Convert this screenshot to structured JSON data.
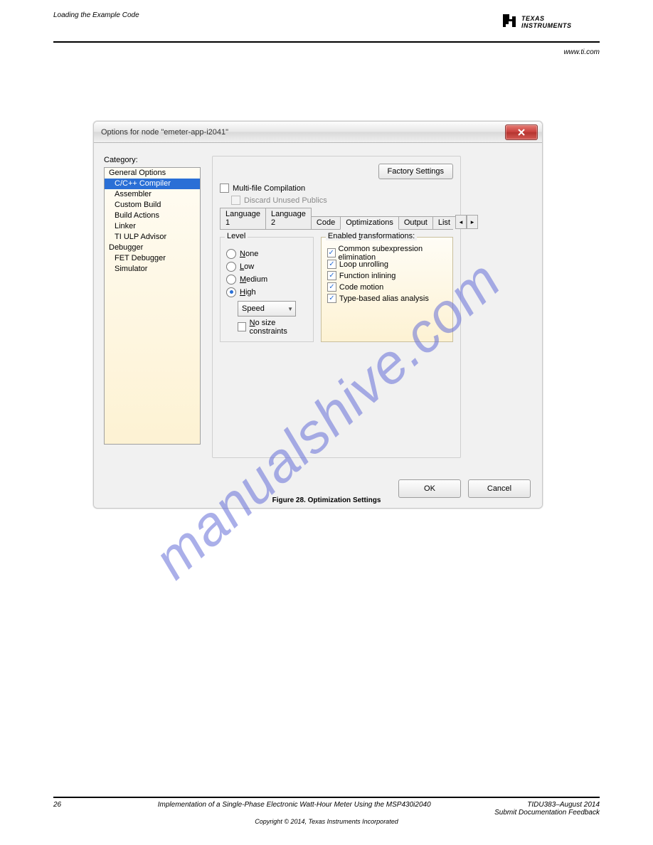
{
  "header": {
    "left_line1": "Loading the Example Code",
    "left_line2": "",
    "logo_text_top": "TEXAS",
    "logo_text_bottom": "INSTRUMENTS",
    "site_link": "www.ti.com"
  },
  "dialog": {
    "title": "Options for node \"emeter-app-i2041\"",
    "category_label": "Category:",
    "categories": [
      {
        "label": "General Options",
        "child": false
      },
      {
        "label": "C/C++ Compiler",
        "child": true,
        "selected": true
      },
      {
        "label": "Assembler",
        "child": true
      },
      {
        "label": "Custom Build",
        "child": true
      },
      {
        "label": "Build Actions",
        "child": true
      },
      {
        "label": "Linker",
        "child": true
      },
      {
        "label": "TI ULP Advisor",
        "child": true
      },
      {
        "label": "Debugger",
        "child": false
      },
      {
        "label": "FET Debugger",
        "child": true
      },
      {
        "label": "Simulator",
        "child": true
      }
    ],
    "factory_button": "Factory Settings",
    "multifile_label": "Multi-file Compilation",
    "discard_label": "Discard Unused Publics",
    "tabs": [
      "Language 1",
      "Language 2",
      "Code",
      "Optimizations",
      "Output",
      "List"
    ],
    "active_tab": "Optimizations",
    "level_legend": "Level",
    "level_options": [
      {
        "key": "N",
        "rest": "one"
      },
      {
        "key": "L",
        "rest": "ow"
      },
      {
        "key": "M",
        "rest": "edium"
      },
      {
        "key": "H",
        "rest": "igh"
      }
    ],
    "level_selected": 3,
    "speed_combo": "Speed",
    "no_size_key": "N",
    "no_size_rest": "o size constraints",
    "trans_legend_pre": "Enabled ",
    "trans_legend_key": "t",
    "trans_legend_rest": "ransformations:",
    "transformations": [
      "Common subexpression elimination",
      "Loop unrolling",
      "Function inlining",
      "Code motion",
      "Type-based alias analysis"
    ],
    "ok_button": "OK",
    "cancel_button": "Cancel"
  },
  "figure_caption": "Figure 28. Optimization Settings",
  "watermark": "manualshive.com",
  "footer": {
    "page_no": "26",
    "title": "Implementation of a Single-Phase Electronic Watt-Hour Meter Using the MSP430i2040",
    "doc_rev": "TIDU383–August 2014",
    "submit_link": "Submit Documentation Feedback",
    "copyright": "Copyright © 2014, Texas Instruments Incorporated"
  }
}
